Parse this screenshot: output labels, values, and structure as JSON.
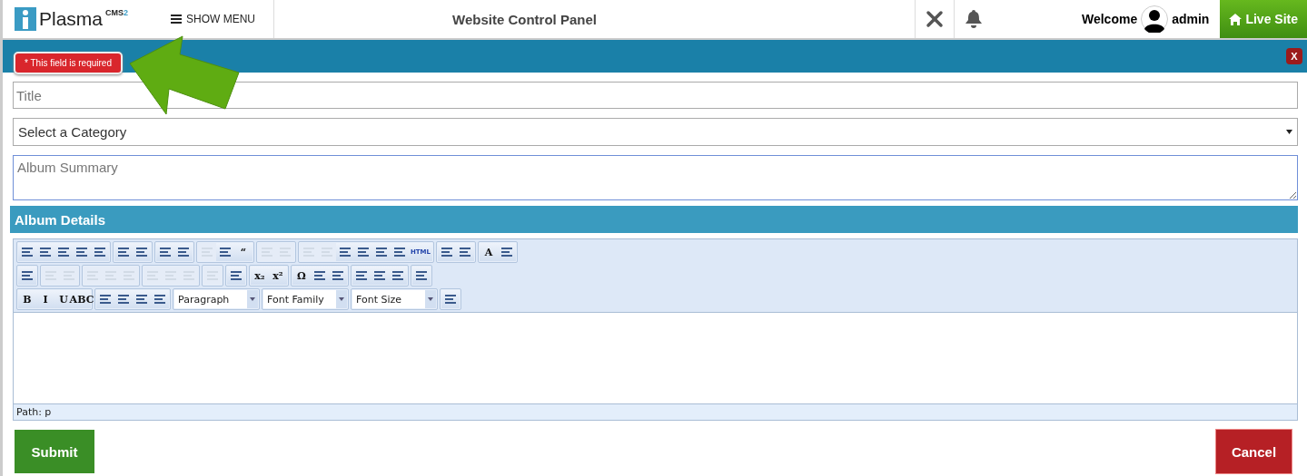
{
  "header": {
    "logo_text": "Plasma",
    "logo_sup": "CMS",
    "logo_sup_num": "2",
    "menu_button": "SHOW MENU",
    "title": "Website Control Panel",
    "welcome": "Welcome",
    "user": "admin",
    "live_site": "Live Site"
  },
  "dialog": {
    "close": "X",
    "tooltip": "* This field is required"
  },
  "form": {
    "title_placeholder": "Title",
    "category": "Select a Category",
    "summary_placeholder": "Album Summary",
    "details_heading": "Album Details"
  },
  "editor": {
    "toolbar_rows": [
      [
        [
          {
            "kind": "icon",
            "disabled": false
          },
          {
            "kind": "icon",
            "disabled": false
          },
          {
            "kind": "icon",
            "disabled": false
          },
          {
            "kind": "icon",
            "disabled": false
          },
          {
            "kind": "icon",
            "disabled": false
          }
        ],
        [
          {
            "kind": "icon",
            "disabled": false
          },
          {
            "kind": "icon",
            "disabled": false
          }
        ],
        [
          {
            "kind": "icon",
            "disabled": false
          },
          {
            "kind": "icon",
            "disabled": false
          }
        ],
        [
          {
            "kind": "icon",
            "disabled": true
          },
          {
            "kind": "icon",
            "disabled": false
          },
          {
            "kind": "glyph",
            "label": "“",
            "disabled": false
          }
        ],
        [
          {
            "kind": "icon",
            "disabled": true
          },
          {
            "kind": "icon",
            "disabled": true
          }
        ],
        [
          {
            "kind": "icon",
            "disabled": true
          },
          {
            "kind": "icon",
            "disabled": true
          },
          {
            "kind": "icon",
            "disabled": false
          },
          {
            "kind": "icon",
            "disabled": false
          },
          {
            "kind": "icon",
            "disabled": false
          },
          {
            "kind": "icon",
            "disabled": false
          },
          {
            "kind": "glyph",
            "label": "HTML",
            "disabled": false
          }
        ],
        [
          {
            "kind": "icon",
            "disabled": false
          },
          {
            "kind": "icon",
            "disabled": false
          }
        ],
        [
          {
            "kind": "glyph",
            "label": "A",
            "disabled": false
          },
          {
            "kind": "icon",
            "disabled": false
          }
        ]
      ],
      [
        [
          {
            "kind": "icon",
            "disabled": false
          }
        ],
        [
          {
            "kind": "icon",
            "disabled": true
          },
          {
            "kind": "icon",
            "disabled": true
          }
        ],
        [
          {
            "kind": "icon",
            "disabled": true
          },
          {
            "kind": "icon",
            "disabled": true
          },
          {
            "kind": "icon",
            "disabled": true
          }
        ],
        [
          {
            "kind": "icon",
            "disabled": true
          },
          {
            "kind": "icon",
            "disabled": true
          },
          {
            "kind": "icon",
            "disabled": true
          }
        ],
        [
          {
            "kind": "icon",
            "disabled": true
          }
        ],
        [
          {
            "kind": "icon",
            "disabled": false
          }
        ],
        [
          {
            "kind": "glyph",
            "label": "x₂",
            "disabled": false
          },
          {
            "kind": "glyph",
            "label": "x²",
            "disabled": false
          }
        ],
        [
          {
            "kind": "glyph",
            "label": "Ω",
            "disabled": false
          },
          {
            "kind": "icon",
            "disabled": false
          },
          {
            "kind": "icon",
            "disabled": false
          }
        ],
        [
          {
            "kind": "icon",
            "disabled": false
          },
          {
            "kind": "icon",
            "disabled": false
          },
          {
            "kind": "icon",
            "disabled": false
          }
        ],
        [
          {
            "kind": "icon",
            "disabled": false
          }
        ]
      ],
      [
        [
          {
            "kind": "glyph",
            "label": "B",
            "disabled": false
          },
          {
            "kind": "glyph",
            "label": "I",
            "disabled": false
          },
          {
            "kind": "glyph",
            "label": "U",
            "disabled": false
          },
          {
            "kind": "glyph",
            "label": "ABC",
            "disabled": false
          }
        ],
        [
          {
            "kind": "icon",
            "disabled": false
          },
          {
            "kind": "icon",
            "disabled": false
          },
          {
            "kind": "icon",
            "disabled": false
          },
          {
            "kind": "icon",
            "disabled": false
          }
        ],
        [
          {
            "kind": "dropdown",
            "label": "Paragraph"
          }
        ],
        [
          {
            "kind": "dropdown",
            "label": "Font Family"
          }
        ],
        [
          {
            "kind": "dropdown",
            "label": "Font Size"
          }
        ],
        [
          {
            "kind": "icon",
            "disabled": false
          }
        ]
      ]
    ],
    "path": "Path: p"
  },
  "actions": {
    "submit": "Submit",
    "cancel": "Cancel"
  }
}
